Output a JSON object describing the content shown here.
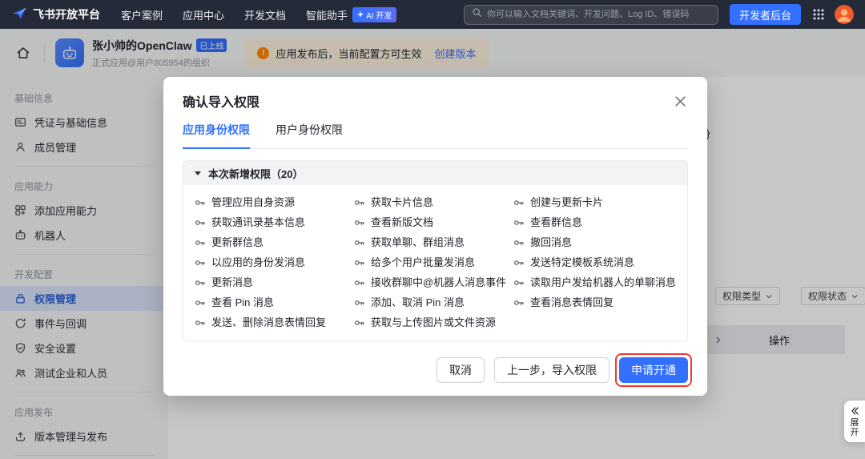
{
  "colors": {
    "brand_blue": "#3370ff",
    "navbar_bg": "#242a37",
    "warning_orange": "#ff8800",
    "highlight_red": "#f5342e"
  },
  "navbar": {
    "brand": "飞书开放平台",
    "items": [
      "客户案例",
      "应用中心",
      "开发文档",
      "智能助手"
    ],
    "ai_badge": "AI 开发",
    "search_placeholder": "你可以输入文档关键词、开发问题、Log ID、错误码",
    "console_button": "开发者后台"
  },
  "app_header": {
    "app_name": "张小帅的OpenClaw",
    "status_badge": "已上线",
    "app_subtitle": "正式应用@用户805954的组织",
    "notice_text": "应用发布后，当前配置方可生效",
    "notice_action": "创建版本"
  },
  "sidebar": {
    "sections": [
      {
        "title": "基础信息",
        "items": [
          {
            "label": "凭证与基础信息"
          },
          {
            "label": "成员管理"
          }
        ]
      },
      {
        "title": "应用能力",
        "items": [
          {
            "label": "添加应用能力"
          },
          {
            "label": "机器人"
          }
        ]
      },
      {
        "title": "开发配置",
        "items": [
          {
            "label": "权限管理",
            "active": true
          },
          {
            "label": "事件与回调"
          },
          {
            "label": "安全设置"
          },
          {
            "label": "测试企业和人员"
          }
        ]
      },
      {
        "title": "应用发布",
        "items": [
          {
            "label": "版本管理与发布"
          }
        ]
      }
    ]
  },
  "content": {
    "partial_heading": "份",
    "filter_type": "权限类型",
    "filter_status": "权限状态",
    "table_action_col": "操作",
    "expand_label": "展开"
  },
  "modal": {
    "title": "确认导入权限",
    "tabs": [
      {
        "label": "应用身份权限",
        "active": true
      },
      {
        "label": "用户身份权限"
      }
    ],
    "group_title": "本次新增权限（20）",
    "permissions": [
      "管理应用自身资源",
      "获取卡片信息",
      "创建与更新卡片",
      "获取通讯录基本信息",
      "查看新版文档",
      "查看群信息",
      "更新群信息",
      "获取单聊、群组消息",
      "撤回消息",
      "以应用的身份发消息",
      "给多个用户批量发消息",
      "发送特定模板系统消息",
      "更新消息",
      "接收群聊中@机器人消息事件",
      "读取用户发给机器人的单聊消息",
      "查看 Pin 消息",
      "添加、取消 Pin 消息",
      "查看消息表情回复",
      "发送、删除消息表情回复",
      "获取与上传图片或文件资源"
    ],
    "buttons": {
      "cancel": "取消",
      "back": "上一步，导入权限",
      "apply": "申请开通"
    }
  }
}
